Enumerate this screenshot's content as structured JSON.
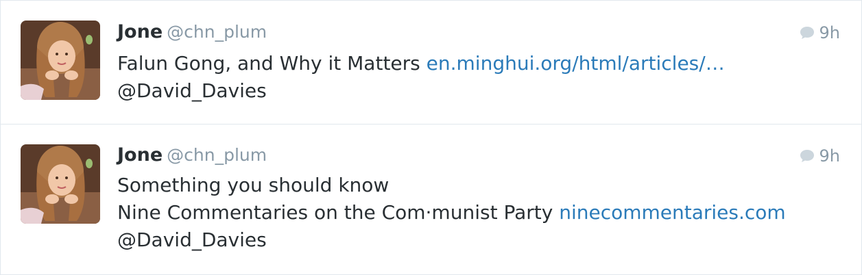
{
  "tweets": [
    {
      "display_name": "Jone",
      "handle": "@chn_plum",
      "time": "9h",
      "icon": "reply-bubble-icon",
      "lines": [
        {
          "text": "Falun Gong, and Why it Matters ",
          "link": "en.minghui.org/html/articles/…"
        },
        {
          "text": "@David_Davies",
          "link": ""
        }
      ]
    },
    {
      "display_name": "Jone",
      "handle": "@chn_plum",
      "time": "9h",
      "icon": "reply-bubble-icon",
      "lines": [
        {
          "text": "Something you should know",
          "link": ""
        },
        {
          "text": "Nine Commentaries on the Com·munist Party ",
          "link": "ninecommentaries.com"
        },
        {
          "text": "@David_Davies",
          "link": ""
        }
      ]
    }
  ],
  "colors": {
    "text": "#292f33",
    "muted": "#8899a6",
    "link": "#2b7bb9",
    "divider": "#e1e8ed"
  }
}
